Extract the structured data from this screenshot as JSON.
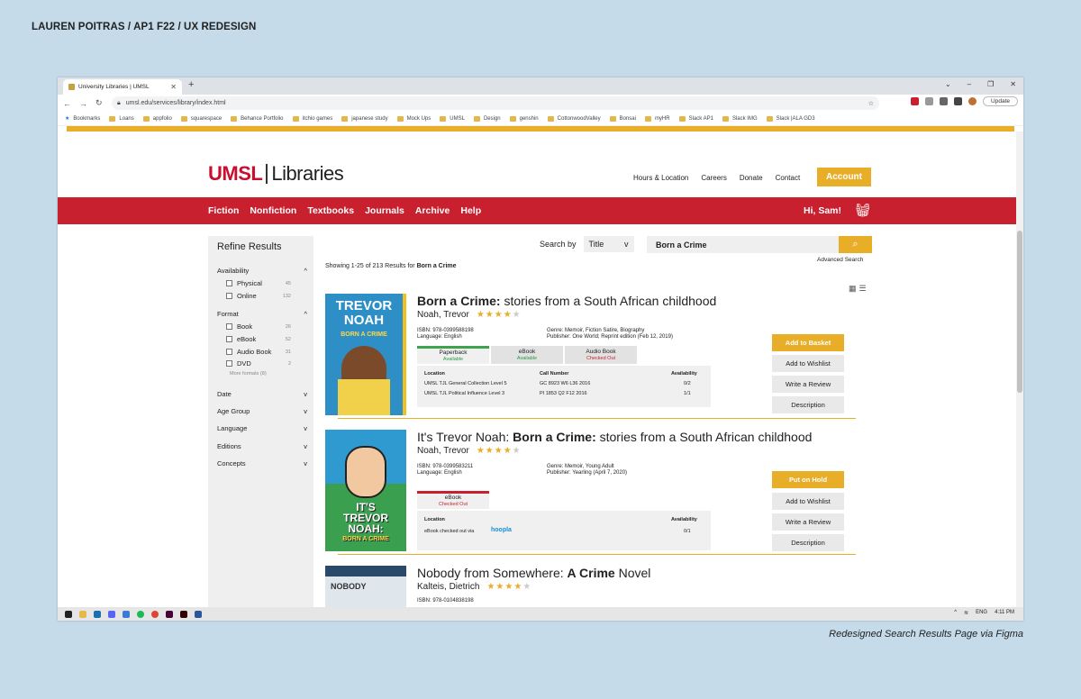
{
  "caption_top": "LAUREN POITRAS / AP1 F22 / UX REDESIGN",
  "caption_bottom": "Redesigned Search Results Page via Figma",
  "browser": {
    "tab_title": "University Libraries | UMSL",
    "url": "umsl.edu/services/library/index.html",
    "update_label": "Update",
    "bookmarks": [
      "Bookmarks",
      "Loans",
      "appfolio",
      "squarespace",
      "Behance Portfolio",
      "itchio games",
      "japanese study",
      "Mock Ups",
      "UMSL",
      "Design",
      "genshin",
      "CottonwoodValley",
      "Bonsai",
      "myHR",
      "Slack AP1",
      "Slack IMG",
      "Slack |ALA GD3"
    ]
  },
  "site": {
    "logo_a": "UMSL",
    "logo_b": "Libraries",
    "topnav": [
      "Hours & Location",
      "Careers",
      "Donate",
      "Contact"
    ],
    "account": "Account",
    "nav": [
      "Fiction",
      "Nonfiction",
      "Textbooks",
      "Journals",
      "Archive",
      "Help"
    ],
    "greeting": "Hi, Sam!"
  },
  "sidebar": {
    "title": "Refine Results",
    "availability": "Availability",
    "physical": "Physical",
    "physical_count": "45",
    "online": "Online",
    "online_count": "132",
    "format": "Format",
    "book": "Book",
    "book_count": "26",
    "ebook": "eBook",
    "ebook_count": "52",
    "audiobook": "Audio Book",
    "audiobook_count": "31",
    "dvd": "DVD",
    "dvd_count": "2",
    "more": "More formats (8)",
    "date": "Date",
    "age": "Age Group",
    "language": "Language",
    "editions": "Editions",
    "concepts": "Concepts",
    "open_mark": "^",
    "closed_mark": "v"
  },
  "search": {
    "label": "Search by",
    "field": "Title",
    "query": "Born a Crime",
    "advanced": "Advanced Search",
    "showing_prefix": "Showing 1-25 of 213 Results for ",
    "showing_query": "Born a Crime"
  },
  "results": [
    {
      "title_bold": "Born a Crime:",
      "title_rest": " stories from a South African childhood",
      "author": "Noah, Trevor",
      "rating": 4,
      "isbn": "ISBN: 978-0399588198",
      "language": "Language: English",
      "genre": "Genre: Memoir, Fiction Satire, Biography",
      "publisher": "Publisher: One World; Reprint edition (Feb 12, 2019)",
      "formats": [
        {
          "name": "Paperback",
          "status": "Available"
        },
        {
          "name": "eBook",
          "status": "Available"
        },
        {
          "name": "Audio Book",
          "status": "Checked Out"
        }
      ],
      "col_location": "Location",
      "col_call": "Call Number",
      "col_avail": "Availability",
      "rows": [
        {
          "loc": "UMSL TJL General Collection Level 5",
          "call": "GC 8923 W6 L36 2016",
          "avail": "0/2"
        },
        {
          "loc": "UMSL TJL Political Influence Level 3",
          "call": "PI 1853 Q2 F12 2016",
          "avail": "1/1"
        }
      ],
      "actions": [
        "Add to Basket",
        "Add to Wishlist",
        "Write a Review",
        "Description"
      ],
      "cover_top": "TREVOR",
      "cover_mid": "NOAH",
      "cover_sub": "BORN A CRIME"
    },
    {
      "title_pre": "It's Trevor Noah: ",
      "title_bold": "Born a Crime:",
      "title_rest": " stories from a South African childhood",
      "author": "Noah, Trevor",
      "rating": 4,
      "isbn": "ISBN: 978-0399583211",
      "language": "Language: English",
      "genre": "Genre: Memoir, Young Adult",
      "publisher": "Publisher: Yearling (April 7, 2020)",
      "format": {
        "name": "eBook",
        "status": "Checked Out"
      },
      "col_location": "Location",
      "col_avail": "Availability",
      "row_loc": "eBook checked out via",
      "row_via": "hoopla",
      "row_avail": "0/1",
      "actions": [
        "Put on Hold",
        "Add to Wishlist",
        "Write a Review",
        "Description"
      ],
      "cover_a": "IT'S",
      "cover_b": "TREVOR",
      "cover_c": "NOAH:",
      "cover_d": "BORN A CRIME"
    },
    {
      "title_pre": "Nobody from Somewhere: ",
      "title_bold": "A Crime",
      "title_rest": " Novel",
      "author": "Kalteis, Dietrich",
      "rating": 4,
      "isbn": "ISBN: 978-0104838198",
      "cover_a": "NOBODY"
    }
  ],
  "taskbar": {
    "lang": "ENG",
    "time": "4:11 PM"
  },
  "colors": {
    "red": "#c8202f",
    "gold": "#e9ae28",
    "green": "#2a9a40"
  }
}
